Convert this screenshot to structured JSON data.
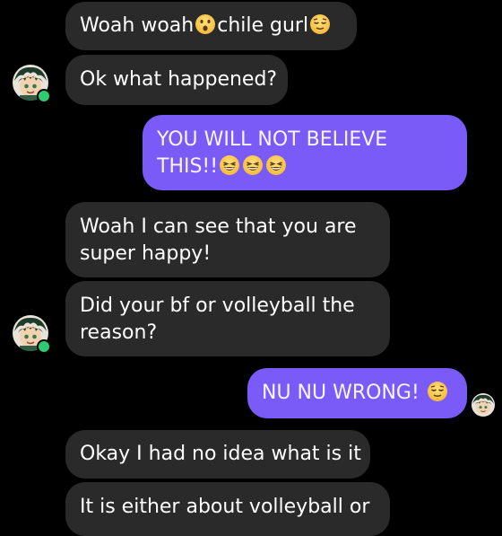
{
  "conversation": {
    "messages": [
      {
        "id": "m1",
        "direction": "incoming",
        "text": "Woah woah",
        "emoji_after": "astonished-face",
        "text2": "chile gurl",
        "emoji_end": "relieved-face"
      },
      {
        "id": "m2",
        "direction": "incoming",
        "text": "Ok what happened?"
      },
      {
        "id": "m3",
        "direction": "outgoing",
        "line1": "YOU WILL NOT BELIEVE",
        "line2": "THIS!!",
        "emojis": [
          "laughing-face",
          "laughing-face",
          "laughing-face"
        ]
      },
      {
        "id": "m4",
        "direction": "incoming",
        "line1": "Woah I can see that you are",
        "line2": "super happy!"
      },
      {
        "id": "m5",
        "direction": "incoming",
        "line1": "Did your bf or volleyball the",
        "line2": "reason?"
      },
      {
        "id": "m6",
        "direction": "outgoing",
        "text": "NU NU WRONG! ",
        "emoji_end": "relieved-face"
      },
      {
        "id": "m7",
        "direction": "incoming",
        "text": "Okay I had no idea what is it"
      },
      {
        "id": "m8",
        "direction": "incoming",
        "text": "It is either about volleyball or"
      }
    ],
    "contact": {
      "avatar": "contact-avatar",
      "status": "online"
    },
    "self": {
      "avatar": "self-avatar"
    }
  },
  "colors": {
    "background": "#000000",
    "incoming_bubble": "#2a2a2b",
    "outgoing_bubble": "#7b5bf7",
    "online_dot": "#2ecc71"
  }
}
